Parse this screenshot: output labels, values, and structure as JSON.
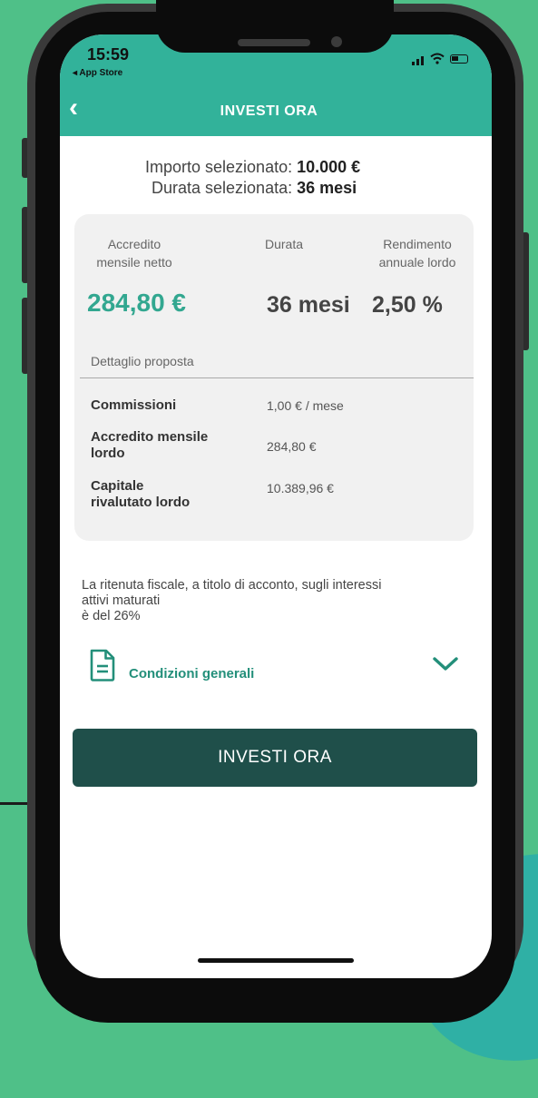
{
  "status_bar": {
    "time": "15:59",
    "back_app": "◂ App Store"
  },
  "header": {
    "title": "INVESTI ORA",
    "back_glyph": "‹"
  },
  "selection": {
    "amount_label": "Importo selezionato:",
    "amount_value": "10.000 €",
    "duration_label": "Durata selezionata:",
    "duration_value": "36 mesi"
  },
  "summary_card": {
    "col1_label_line1": "Accredito",
    "col1_label_line2": "mensile netto",
    "col2_label": "Durata",
    "col3_label_line1": "Rendimento",
    "col3_label_line2": "annuale lordo",
    "monthly_net": "284,80 €",
    "duration": "36 mesi",
    "annual_yield": "2,50 %",
    "detail_title": "Dettaglio proposta",
    "details": [
      {
        "label_line1": "Commissioni",
        "label_line2": "",
        "value": "1,00 € / mese"
      },
      {
        "label_line1": "Accredito mensile",
        "label_line2": "lordo",
        "value": "284,80 €"
      },
      {
        "label_line1": "Capitale",
        "label_line2": "rivalutato lordo",
        "value": "10.389,96 €"
      }
    ]
  },
  "tax_note": {
    "line1": "La ritenuta fiscale, a titolo di acconto, sugli interessi",
    "line2": "attivi maturati",
    "line3": "è del 26%"
  },
  "conditions": {
    "label": "Condizioni generali"
  },
  "cta": {
    "label": "INVESTI ORA"
  },
  "colors": {
    "background": "#4fc088",
    "accent": "#32b29a",
    "accent_text": "#238f7a",
    "cta": "#1f4f4a"
  },
  "icons": [
    "back-chevron-icon",
    "document-icon",
    "chevron-down-icon",
    "signal-icon",
    "wifi-icon",
    "battery-icon"
  ]
}
